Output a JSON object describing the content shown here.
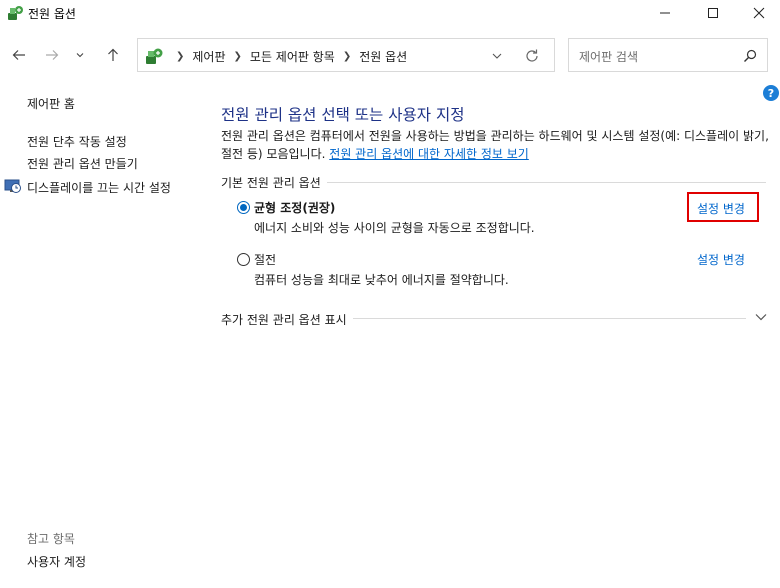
{
  "window": {
    "title": "전원 옵션"
  },
  "address": {
    "crumbs": [
      "제어판",
      "모든 제어판 항목",
      "전원 옵션"
    ]
  },
  "search": {
    "placeholder": "제어판 검색"
  },
  "left_nav": {
    "home": "제어판 홈",
    "items": [
      "전원 단추 작동 설정",
      "전원 관리 옵션 만들기",
      "디스플레이를 끄는 시간 설정"
    ],
    "see_also_heading": "참고 항목",
    "see_also_items": [
      "사용자 계정"
    ]
  },
  "help": {
    "label": "?"
  },
  "main": {
    "title": "전원 관리 옵션 선택 또는 사용자 지정",
    "description": "전원 관리 옵션은 컴퓨터에서 전원을 사용하는 방법을 관리하는 하드웨어 및 시스템 설정(예: 디스플레이 밝기, 절전 등) 모음입니다.",
    "description_link": "전원 관리 옵션에 대한 자세한 정보 보기",
    "section_label": "기본 전원 관리 옵션",
    "plans": [
      {
        "name": "균형 조정(권장)",
        "description": "에너지 소비와 성능 사이의 균형을 자동으로 조정합니다.",
        "selected": true,
        "change_label": "설정 변경"
      },
      {
        "name": "절전",
        "description": "컴퓨터 성능을 최대로 낮추어 에너지를 절약합니다.",
        "selected": false,
        "change_label": "설정 변경"
      }
    ],
    "more_plans_label": "추가 전원 관리 옵션 표시"
  },
  "colors": {
    "accent": "#0067c0",
    "link": "#0066cc",
    "title": "#1e3287",
    "highlight": "#e00000"
  },
  "icons": [
    "power-options-icon",
    "minimize-icon",
    "maximize-icon",
    "close-icon",
    "back-arrow-icon",
    "forward-arrow-icon",
    "recent-locations-icon",
    "up-arrow-icon",
    "control-panel-icon",
    "chevron-right-icon",
    "dropdown-icon",
    "refresh-icon",
    "search-icon",
    "display-clock-icon",
    "help-icon",
    "chevron-down-icon"
  ]
}
